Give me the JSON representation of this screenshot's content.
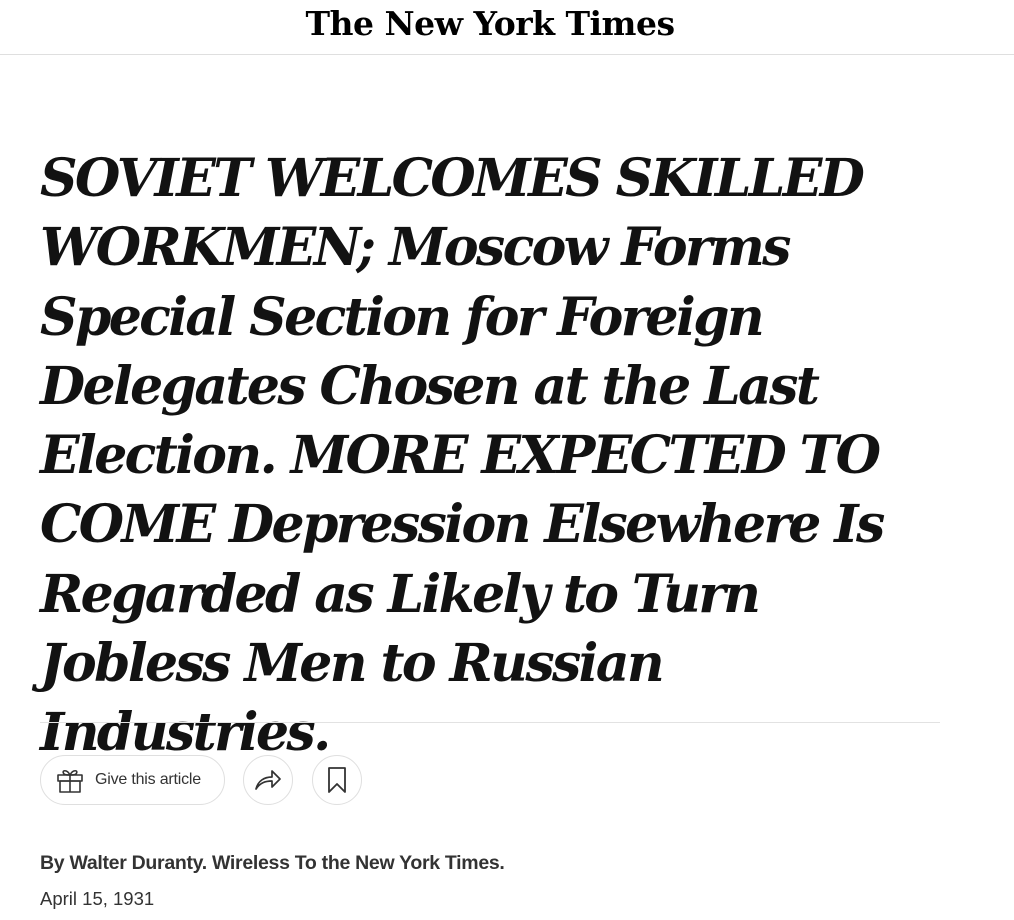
{
  "masthead": {
    "logo_text": "The New York Times"
  },
  "article": {
    "headline": "SOVIET WELCOMES SKILLED WORKMEN; Moscow Forms Special Section for Foreign Delegates Chosen at the Last Election. MORE EXPECTED TO COME Depression Elsewhere Is Regarded as Likely to Turn Jobless Men to Russian Industries.",
    "byline": "By Walter Duranty. Wireless To the New York Times.",
    "date": "April 15, 1931"
  },
  "actions": {
    "gift_label": "Give this article",
    "gift_icon": "gift-icon",
    "share_icon": "share-icon",
    "save_icon": "bookmark-icon"
  }
}
